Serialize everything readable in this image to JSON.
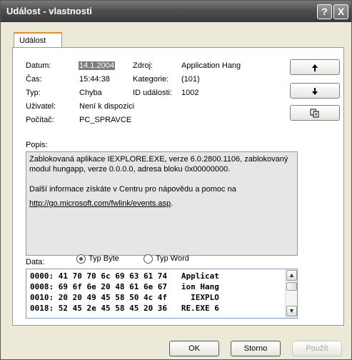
{
  "window": {
    "title": "Událost - vlastnosti",
    "help_button": "?",
    "close_button": "X"
  },
  "tab": {
    "label": "Událost"
  },
  "fields": {
    "date_label": "Datum:",
    "date_value": "14.1.2004",
    "source_label": "Zdroj:",
    "source_value": "Application Hang",
    "time_label": "Čas:",
    "time_value": "15:44:38",
    "category_label": "Kategorie:",
    "category_value": "(101)",
    "type_label": "Typ:",
    "type_value": "Chyba",
    "event_id_label": "ID události:",
    "event_id_value": "1002",
    "user_label": "Uživatel:",
    "user_value": "Není k dispozici",
    "computer_label": "Počítač:",
    "computer_value": "PC_SPRAVCE"
  },
  "description": {
    "label": "Popis:",
    "line1": "Zablokovaná aplikace IEXPLORE.EXE, verze 6.0.2800.1106, zablokovaný modul hungapp, verze 0.0.0.0, adresa bloku 0x00000000.",
    "line2": "Další informace získáte v Centru pro nápovědu a pomoc na",
    "link": "http://go.microsoft.com/fwlink/events.asp",
    "after_link": "."
  },
  "data_section": {
    "label": "Data:",
    "radio_byte": "Typ Byte",
    "radio_word": "Typ Word",
    "selected": "byte",
    "hex_lines": [
      "0000: 41 70 70 6c 69 63 61 74   Applicat",
      "0008: 69 6f 6e 20 48 61 6e 67   ion Hang",
      "0010: 20 20 49 45 58 50 4c 4f     IEXPLO",
      "0018: 52 45 2e 45 58 45 20 36   RE.EXE 6"
    ]
  },
  "side_buttons": {
    "up_icon": "arrow-up",
    "down_icon": "arrow-down",
    "copy_icon": "copy"
  },
  "footer": {
    "ok": "OK",
    "cancel": "Storno",
    "apply": "Použít"
  }
}
